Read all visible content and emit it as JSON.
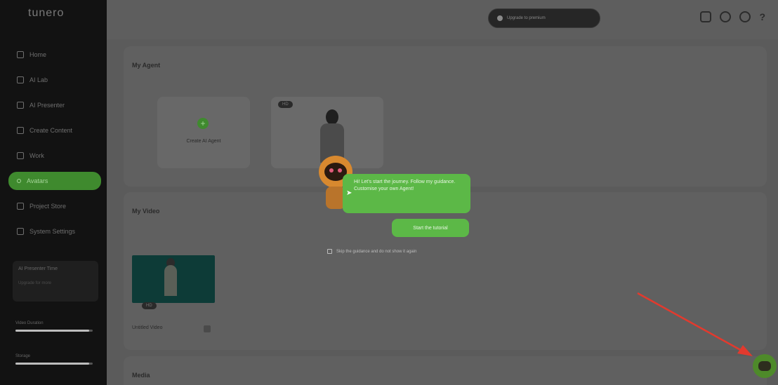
{
  "sidebar": {
    "logo": "tunero",
    "items": [
      {
        "label": "Home",
        "icon": "home-icon"
      },
      {
        "label": "AI Lab",
        "icon": "lab-icon"
      },
      {
        "label": "AI Presenter",
        "icon": "presenter-icon"
      },
      {
        "label": "Create Content",
        "icon": "content-icon"
      },
      {
        "label": "Work",
        "icon": "work-icon"
      },
      {
        "label": "Avatars",
        "icon": "avatar-icon",
        "active": true
      },
      {
        "label": "Project Store",
        "icon": "store-icon"
      },
      {
        "label": "System Settings",
        "icon": "settings-icon"
      }
    ],
    "credits": {
      "title": "AI Presenter Time",
      "subtitle": "Upgrade for more"
    },
    "usage1": {
      "label": "Video Duration",
      "fraction": 0.95
    },
    "usage2": {
      "label": "Storage",
      "fraction": 0.95
    }
  },
  "topbar": {
    "promo": "Upgrade to premium"
  },
  "sections": {
    "avatars_title": "My Agent",
    "create_label": "Create AI Agent",
    "person_tag": "HD",
    "videos_title": "My Video",
    "video_tag": "HD",
    "video_name": "Untitled Video",
    "media_title": "Media"
  },
  "tour": {
    "bubble_text": "Hi! Let's start the journey. Follow my guidance. Customise your own Agent!",
    "start_button": "Start the tutorial",
    "skip_label": "Skip the guidance and do not show it again"
  },
  "colors": {
    "accent_green": "#5cb847",
    "sidebar_bg": "#121212",
    "arrow_red": "#e23a2e"
  }
}
